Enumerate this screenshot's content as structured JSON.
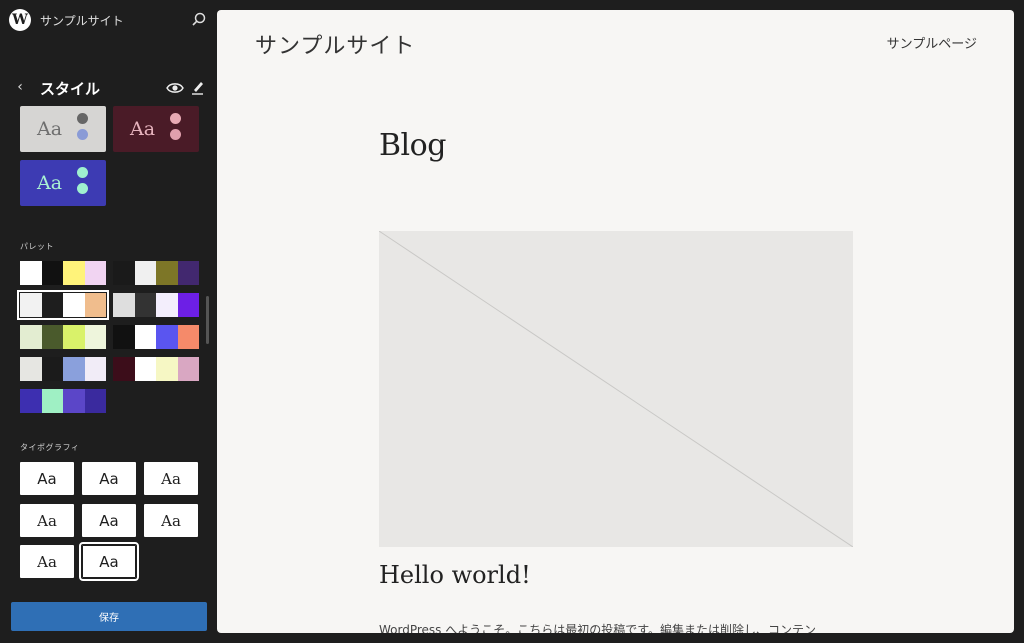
{
  "header": {
    "site_name": "サンプルサイト",
    "logo_letter": "W"
  },
  "styles": {
    "title": "スタイル",
    "back_glyph": "‹"
  },
  "variations": [
    {
      "aa": "Aa",
      "bg": "#d6d5d3",
      "text": "#6f6f6f",
      "dot1": "#666666",
      "dot2": "#8a9bd6"
    },
    {
      "aa": "Aa",
      "bg": "#4a1b27",
      "text": "#e6b3bd",
      "dot1": "#e8aab4",
      "dot2": "#e0a0ad"
    },
    {
      "aa": "Aa",
      "bg": "#3d3bb3",
      "text": "#a8f0d3",
      "dot1": "#9ff0cf",
      "dot2": "#9ff0cf"
    }
  ],
  "palette_label": "パレット",
  "palettes": [
    {
      "colors": [
        "#ffffff",
        "#111111",
        "#fff37a",
        "#f1d4f2"
      ]
    },
    {
      "colors": [
        "#1a1a1a",
        "#f0f0f0",
        "#7d7627",
        "#42286f"
      ]
    },
    {
      "colors": [
        "#f2f2f2",
        "#1e1e1e",
        "#ffffff",
        "#f0bd8d"
      ],
      "selected": true
    },
    {
      "colors": [
        "#dedede",
        "#333333",
        "#f3eefc",
        "#6d1fe6"
      ]
    },
    {
      "colors": [
        "#e3edd1",
        "#4a5a2c",
        "#d9f26a",
        "#eef5dc"
      ]
    },
    {
      "colors": [
        "#111111",
        "#ffffff",
        "#5a55f0",
        "#f58a6a"
      ]
    },
    {
      "colors": [
        "#e6e6e2",
        "#1b1b1b",
        "#8aa0dc",
        "#f1ecf7"
      ]
    },
    {
      "colors": [
        "#3c0d1a",
        "#ffffff",
        "#f6f7c4",
        "#d9a7c2"
      ]
    },
    {
      "colors": [
        "#3d2fb0",
        "#9ff0c4",
        "#5b46c8",
        "#3a2a9e"
      ]
    }
  ],
  "typography_label": "タイポグラフィ",
  "typography": [
    {
      "aa": "Aa",
      "font": "DejaVu Sans"
    },
    {
      "aa": "Aa",
      "font": "DejaVu Sans"
    },
    {
      "aa": "Aa",
      "font": "DejaVu Serif"
    },
    {
      "aa": "Aa",
      "font": "DejaVu Serif"
    },
    {
      "aa": "Aa",
      "font": "DejaVu Sans"
    },
    {
      "aa": "Aa",
      "font": "DejaVu Serif"
    },
    {
      "aa": "Aa",
      "font": "DejaVu Serif"
    },
    {
      "aa": "Aa",
      "font": "DejaVu Sans",
      "selected": true
    }
  ],
  "save_label": "保存",
  "canvas": {
    "site_title": "サンプルサイト",
    "nav_item": "サンプルページ",
    "blog_title": "Blog",
    "post_title": "Hello world!",
    "excerpt": "WordPress へようこそ。こちらは最初の投稿です。編集または削除し、コンテン"
  },
  "colors": {
    "sidebar_bg": "#1e1e1e",
    "canvas_bg": "#f7f6f4",
    "save_button": "#2f6fb5"
  }
}
